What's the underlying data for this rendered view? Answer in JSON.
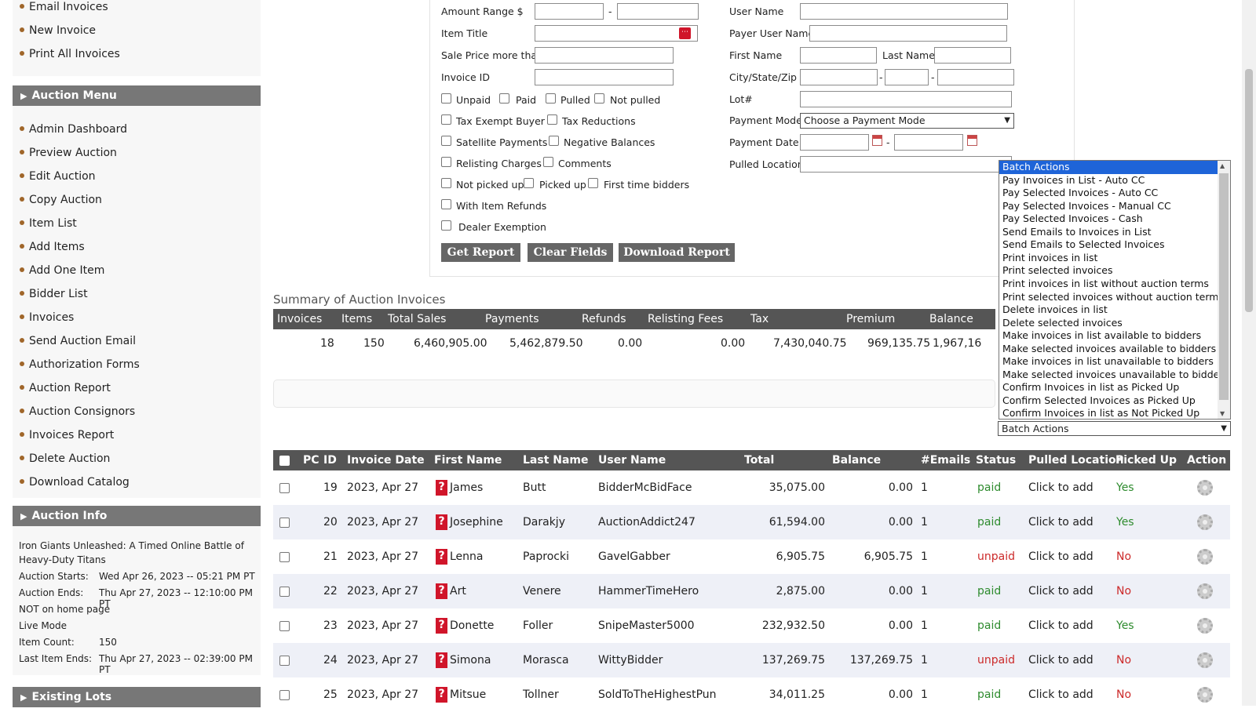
{
  "sidebar": {
    "invoice_items": [
      "Email Invoices",
      "New Invoice",
      "Print All Invoices"
    ],
    "auction_menu_title": "Auction Menu",
    "auction_menu_items": [
      "Admin Dashboard",
      "Preview Auction",
      "Edit Auction",
      "Copy Auction",
      "Item List",
      "Add Items",
      "Add One Item",
      "Bidder List",
      "Invoices",
      "Send Auction Email",
      "Authorization Forms",
      "Auction Report",
      "Auction Consignors",
      "Invoices Report",
      "Delete Auction",
      "Download Catalog"
    ],
    "auction_info_title": "Auction Info",
    "auction_info": {
      "name_line1": "Iron Giants Unleashed: A Timed Online Battle of",
      "name_line2": "Heavy-Duty Titans",
      "starts_label": "Auction Starts:",
      "starts_value": "Wed Apr 26, 2023 -- 05:21 PM PT",
      "ends_label": "Auction Ends:",
      "ends_value": "Thu Apr 27, 2023 -- 12:10:00 PM PT",
      "home_page": "NOT on home page",
      "mode": "Live Mode",
      "count_label": "Item Count:",
      "count_value": "150",
      "last_label": "Last Item Ends:",
      "last_value": "Thu Apr 27, 2023 -- 02:39:00 PM PT"
    },
    "existing_lots_title": "Existing Lots"
  },
  "filters": {
    "amount_range": "Amount Range  $",
    "dash": "-",
    "item_title": "Item Title",
    "sale_price": "Sale Price more than",
    "invoice_id": "Invoice ID",
    "user_name": "User Name",
    "payer_user_name": "Payer User Name",
    "first_name": "First Name",
    "last_name": "Last Name",
    "city_state_zip": "City/State/Zip",
    "lot": "Lot#",
    "payment_mode": "Payment Mode",
    "payment_mode_value": "Choose a Payment Mode",
    "payment_date": "Payment Date",
    "pulled_location": "Pulled Location",
    "checks": {
      "unpaid": "Unpaid",
      "paid": "Paid",
      "pulled": "Pulled",
      "not_pulled": "Not pulled",
      "tax_exempt": "Tax Exempt Buyer",
      "tax_reductions": "Tax Reductions",
      "satellite": "Satellite Payments",
      "negative": "Negative Balances",
      "relisting": "Relisting Charges",
      "comments": "Comments",
      "not_picked": "Not picked up",
      "picked": "Picked up",
      "first_time": "First time bidders",
      "refunds": "With Item Refunds",
      "dealer": "Dealer Exemption"
    },
    "get_report": "Get Report",
    "clear_fields": "Clear Fields",
    "download_report": "Download Report"
  },
  "summary": {
    "title": "Summary of Auction Invoices",
    "headers": [
      "Invoices",
      "Items",
      "Total Sales",
      "Payments",
      "Refunds",
      "Relisting Fees",
      "Tax",
      "Premium",
      "Balance Due"
    ],
    "values": [
      "18",
      "150",
      "6,460,905.00",
      "5,462,879.50",
      "0.00",
      "0.00",
      "7,430,040.75",
      "969,135.75",
      "1,967,16"
    ]
  },
  "batch": {
    "selected": "Batch Actions",
    "options": [
      "Batch Actions",
      "Pay Invoices in List - Auto CC",
      "Pay Selected Invoices - Auto CC",
      "Pay Selected Invoices - Manual CC",
      "Pay Selected Invoices - Cash",
      "Send Emails to Invoices in List",
      "Send Emails to Selected Invoices",
      "Print invoices in list",
      "Print selected invoices",
      "Print invoices in list without auction terms",
      "Print selected invoices without auction terms",
      "Delete invoices in list",
      "Delete selected invoices",
      "Make invoices in list available to bidders",
      "Make selected invoices available to bidders",
      "Make invoices in list unavailable to bidders",
      "Make selected invoices unavailable to bidders",
      "Confirm Invoices in list as Picked Up",
      "Confirm Selected Invoices as Picked Up",
      "Confirm Invoices in list as Not Picked Up"
    ]
  },
  "invoices": {
    "headers": [
      "PC",
      "ID",
      "Invoice Date",
      "First Name",
      "Last Name",
      "User Name",
      "Total",
      "Balance",
      "#Emails",
      "Status",
      "Pulled Location",
      "Picked Up",
      "Action"
    ],
    "rows": [
      {
        "id": "19",
        "date": "2023, Apr 27",
        "first": "James",
        "last": "Butt",
        "user": "BidderMcBidFace",
        "total": "35,075.00",
        "balance": "0.00",
        "emails": "1",
        "status": "paid",
        "pulled": "Click to add",
        "picked": "Yes"
      },
      {
        "id": "20",
        "date": "2023, Apr 27",
        "first": "Josephine",
        "last": "Darakjy",
        "user": "AuctionAddict247",
        "total": "61,594.00",
        "balance": "0.00",
        "emails": "1",
        "status": "paid",
        "pulled": "Click to add",
        "picked": "Yes"
      },
      {
        "id": "21",
        "date": "2023, Apr 27",
        "first": "Lenna",
        "last": "Paprocki",
        "user": "GavelGabber",
        "total": "6,905.75",
        "balance": "6,905.75",
        "emails": "1",
        "status": "unpaid",
        "pulled": "Click to add",
        "picked": "No"
      },
      {
        "id": "22",
        "date": "2023, Apr 27",
        "first": "Art",
        "last": "Venere",
        "user": "HammerTimeHero",
        "total": "2,875.00",
        "balance": "0.00",
        "emails": "1",
        "status": "paid",
        "pulled": "Click to add",
        "picked": "No"
      },
      {
        "id": "23",
        "date": "2023, Apr 27",
        "first": "Donette",
        "last": "Foller",
        "user": "SnipeMaster5000",
        "total": "232,932.50",
        "balance": "0.00",
        "emails": "1",
        "status": "paid",
        "pulled": "Click to add",
        "picked": "Yes"
      },
      {
        "id": "24",
        "date": "2023, Apr 27",
        "first": "Simona",
        "last": "Morasca",
        "user": "WittyBidder",
        "total": "137,269.75",
        "balance": "137,269.75",
        "emails": "1",
        "status": "unpaid",
        "pulled": "Click to add",
        "picked": "No"
      },
      {
        "id": "25",
        "date": "2023, Apr 27",
        "first": "Mitsue",
        "last": "Tollner",
        "user": "SoldToTheHighestPun",
        "total": "34,011.25",
        "balance": "0.00",
        "emails": "1",
        "status": "paid",
        "pulled": "Click to add",
        "picked": "No"
      }
    ],
    "question_mark": "?"
  },
  "colors": {
    "header_bg": "#555555",
    "paid": "#2e8b2e",
    "unpaid": "#cc2a2a",
    "selected_option": "#1e64d8",
    "question_badge": "#d0152a"
  }
}
